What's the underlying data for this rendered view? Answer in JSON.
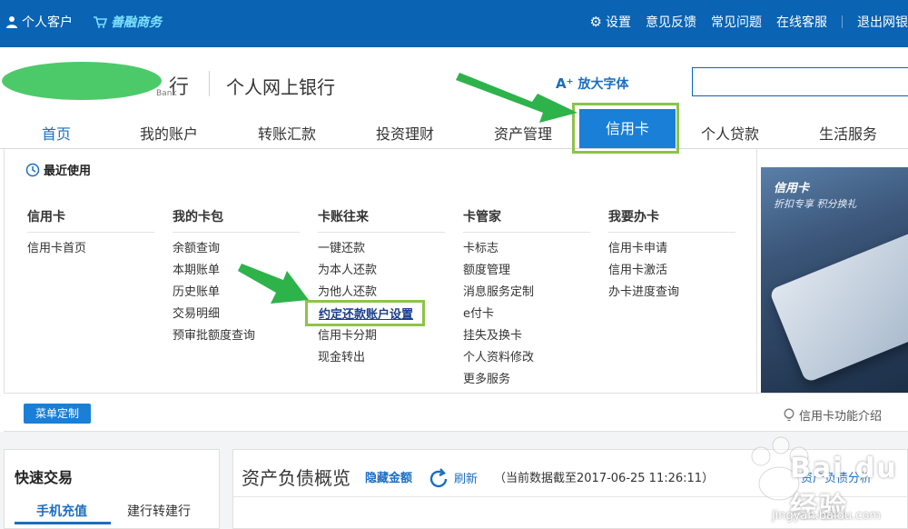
{
  "topbar": {
    "personal": "个人客户",
    "business": "善融商务",
    "settings": "设置",
    "feedback": "意见反馈",
    "faq": "常见问题",
    "service": "在线客服",
    "logout": "退出网银"
  },
  "header": {
    "logo_char": "行",
    "logo_sub": "Bank",
    "site_name": "个人网上银行",
    "enlarge_font": "放大字体"
  },
  "nav": {
    "tabs": [
      "首页",
      "我的账户",
      "转账汇款",
      "投资理财",
      "资产管理",
      "信用卡",
      "个人贷款",
      "生活服务"
    ]
  },
  "panel": {
    "recent": "最近使用",
    "columns": [
      {
        "title": "信用卡",
        "items": [
          "信用卡首页"
        ]
      },
      {
        "title": "我的卡包",
        "items": [
          "余额查询",
          "本期账单",
          "历史账单",
          "交易明细",
          "预审批额度查询"
        ]
      },
      {
        "title": "卡账往来",
        "items": [
          "一键还款",
          "为本人还款",
          "为他人还款",
          "约定还款账户设置",
          "信用卡分期",
          "现金转出"
        ]
      },
      {
        "title": "卡管家",
        "items": [
          "卡标志",
          "额度管理",
          "消息服务定制",
          "e付卡",
          "挂失及换卡",
          "个人资料修改",
          "更多服务"
        ]
      },
      {
        "title": "我要办卡",
        "items": [
          "信用卡申请",
          "信用卡激活",
          "办卡进度查询"
        ]
      }
    ],
    "menu_custom": "菜单定制",
    "func_intro": "信用卡功能介绍",
    "promo_title": "信用卡",
    "promo_sub": "折扣专享 积分换礼"
  },
  "quick": {
    "title": "快速交易",
    "tab1": "手机充值",
    "tab2": "建行转建行"
  },
  "asset": {
    "title": "资产负债概览",
    "hide": "隐藏金额",
    "refresh": "刷新",
    "date": "（当前数据截至2017-06-25 11:26:11）",
    "analysis": "资产负债分析"
  },
  "watermark": {
    "brand": "Bai du 经验",
    "url": "jingyan.baidu.com"
  },
  "colors": {
    "brand_blue": "#0a63b3",
    "active_tab": "#1a7fd6",
    "highlight_green": "#8dc34a",
    "arrow_green": "#2db34a"
  }
}
